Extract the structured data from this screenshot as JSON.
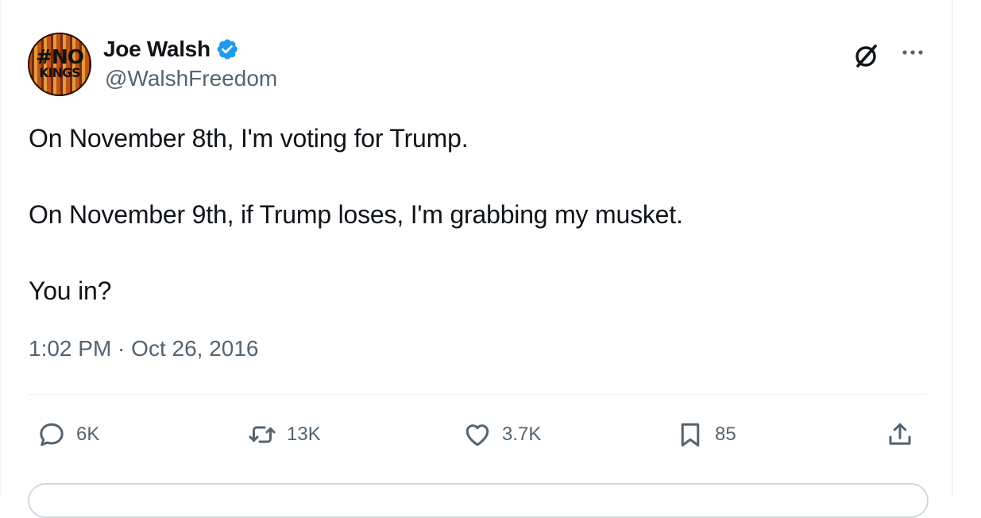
{
  "author": {
    "display_name": "Joe Walsh",
    "handle": "@WalshFreedom",
    "avatar_text_line1": "#NO",
    "avatar_text_line2": "KINGS",
    "verified_color": "#1d9bf0"
  },
  "tweet": {
    "lines": [
      "On November 8th, I'm voting for Trump.",
      "On November 9th, if Trump loses, I'm grabbing my musket.",
      "You in?"
    ],
    "timestamp": "1:02 PM · Oct 26, 2016"
  },
  "actions": {
    "reply_count": "6K",
    "repost_count": "13K",
    "like_count": "3.7K",
    "bookmark_count": "85"
  },
  "icons": [
    "verified-badge-icon",
    "grok-icon",
    "more-icon",
    "reply-icon",
    "repost-icon",
    "like-icon",
    "bookmark-icon",
    "share-icon"
  ],
  "colors": {
    "text": "#0f1419",
    "secondary": "#536471",
    "accent": "#1d9bf0"
  }
}
